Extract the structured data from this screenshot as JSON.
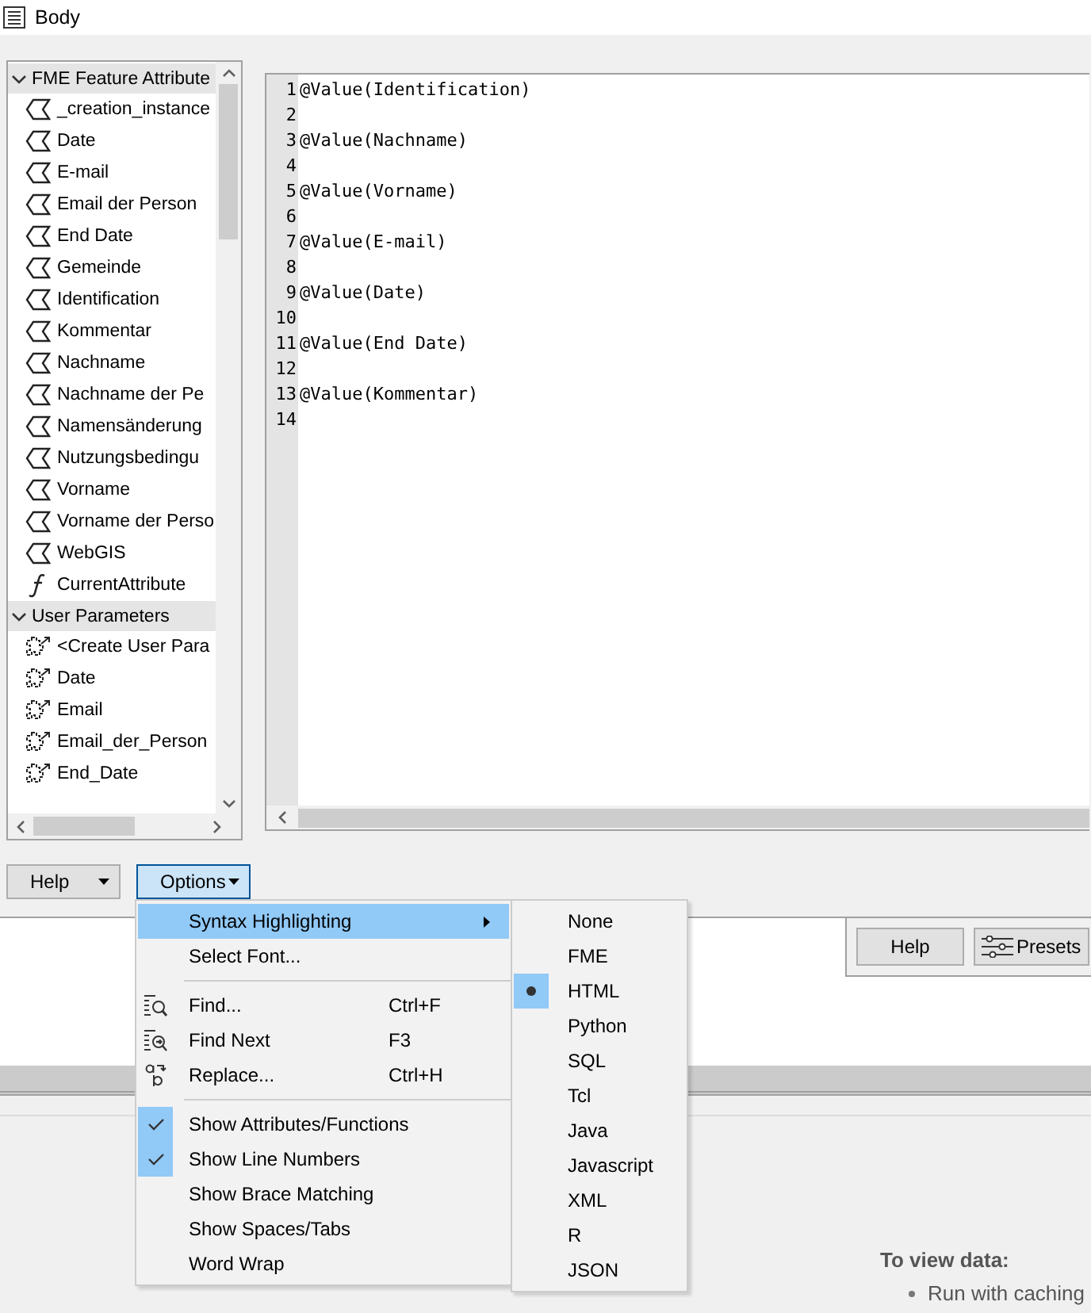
{
  "window": {
    "title": "Body"
  },
  "tree": {
    "groups": [
      {
        "label": "FME Feature Attribute",
        "expanded": true,
        "items": [
          {
            "label": "_creation_instance",
            "kind": "attribute"
          },
          {
            "label": "Date",
            "kind": "attribute"
          },
          {
            "label": "E-mail",
            "kind": "attribute"
          },
          {
            "label": "Email der Person",
            "kind": "attribute"
          },
          {
            "label": "End Date",
            "kind": "attribute"
          },
          {
            "label": "Gemeinde",
            "kind": "attribute"
          },
          {
            "label": "Identification",
            "kind": "attribute"
          },
          {
            "label": "Kommentar",
            "kind": "attribute"
          },
          {
            "label": "Nachname",
            "kind": "attribute"
          },
          {
            "label": "Nachname der Pe",
            "kind": "attribute"
          },
          {
            "label": "Namensänderung",
            "kind": "attribute"
          },
          {
            "label": "Nutzungsbedingu",
            "kind": "attribute"
          },
          {
            "label": "Vorname",
            "kind": "attribute"
          },
          {
            "label": "Vorname der Perso",
            "kind": "attribute"
          },
          {
            "label": "WebGIS",
            "kind": "attribute"
          },
          {
            "label": "CurrentAttribute",
            "kind": "function"
          }
        ]
      },
      {
        "label": "User Parameters",
        "expanded": true,
        "items": [
          {
            "label": "<Create User Para",
            "kind": "parameter"
          },
          {
            "label": "Date",
            "kind": "parameter"
          },
          {
            "label": "Email",
            "kind": "parameter"
          },
          {
            "label": "Email_der_Person",
            "kind": "parameter"
          },
          {
            "label": "End_Date",
            "kind": "parameter"
          }
        ]
      }
    ]
  },
  "editor": {
    "lines": [
      {
        "number": "1",
        "text": "@Value(Identification)"
      },
      {
        "number": "2"
      },
      {
        "number": "3",
        "text": "@Value(Nachname)"
      },
      {
        "number": "4"
      },
      {
        "number": "5",
        "text": "@Value(Vorname)"
      },
      {
        "number": "6"
      },
      {
        "number": "7",
        "text": "@Value(E-mail)"
      },
      {
        "number": "8"
      },
      {
        "number": "9",
        "text": "@Value(Date)"
      },
      {
        "number": "10"
      },
      {
        "number": "11",
        "text": "@Value(End Date)"
      },
      {
        "number": "12"
      },
      {
        "number": "13",
        "text": "@Value(Kommentar)"
      },
      {
        "number": "14"
      }
    ]
  },
  "buttons": [
    {
      "label": "Help",
      "selected": false
    },
    {
      "label": "Options",
      "selected": true
    }
  ],
  "options_menu": [
    {
      "kind": "submenu",
      "label": "Syntax Highlighting",
      "highlighted": true
    },
    {
      "kind": "command",
      "label": "Select Font...",
      "highlighted": false
    },
    {
      "kind": "separator"
    },
    {
      "kind": "find",
      "label": "Find...",
      "shortcut": "Ctrl+F",
      "highlighted": false
    },
    {
      "kind": "find_next",
      "label": "Find Next",
      "shortcut": "F3",
      "highlighted": false
    },
    {
      "kind": "replace",
      "label": "Replace...",
      "shortcut": "Ctrl+H",
      "highlighted": false
    },
    {
      "kind": "separator"
    },
    {
      "kind": "toggle",
      "label": "Show Attributes/Functions",
      "checked": true,
      "highlighted": false
    },
    {
      "kind": "toggle",
      "label": "Show Line Numbers",
      "checked": true,
      "highlighted": false
    },
    {
      "kind": "toggle",
      "label": "Show Brace Matching",
      "checked": false,
      "highlighted": false
    },
    {
      "kind": "toggle",
      "label": "Show Spaces/Tabs",
      "checked": false,
      "highlighted": false
    },
    {
      "kind": "toggle",
      "label": "Word Wrap",
      "checked": false,
      "highlighted": false
    }
  ],
  "syntax_menu": [
    {
      "label": "None",
      "selected": false
    },
    {
      "label": "FME",
      "selected": false
    },
    {
      "label": "HTML",
      "selected": true
    },
    {
      "label": "Python",
      "selected": false
    },
    {
      "label": "SQL",
      "selected": false
    },
    {
      "label": "Tcl",
      "selected": false
    },
    {
      "label": "Java",
      "selected": false
    },
    {
      "label": "Javascript",
      "selected": false
    },
    {
      "label": "XML",
      "selected": false
    },
    {
      "label": "R",
      "selected": false
    },
    {
      "label": "JSON",
      "selected": false
    }
  ],
  "panel_buttons": [
    {
      "label": "Help",
      "kind": "plain"
    },
    {
      "label": "Presets",
      "kind": "presets"
    }
  ],
  "info": {
    "heading": "To view data:",
    "bullets": [
      "Run with caching"
    ]
  }
}
